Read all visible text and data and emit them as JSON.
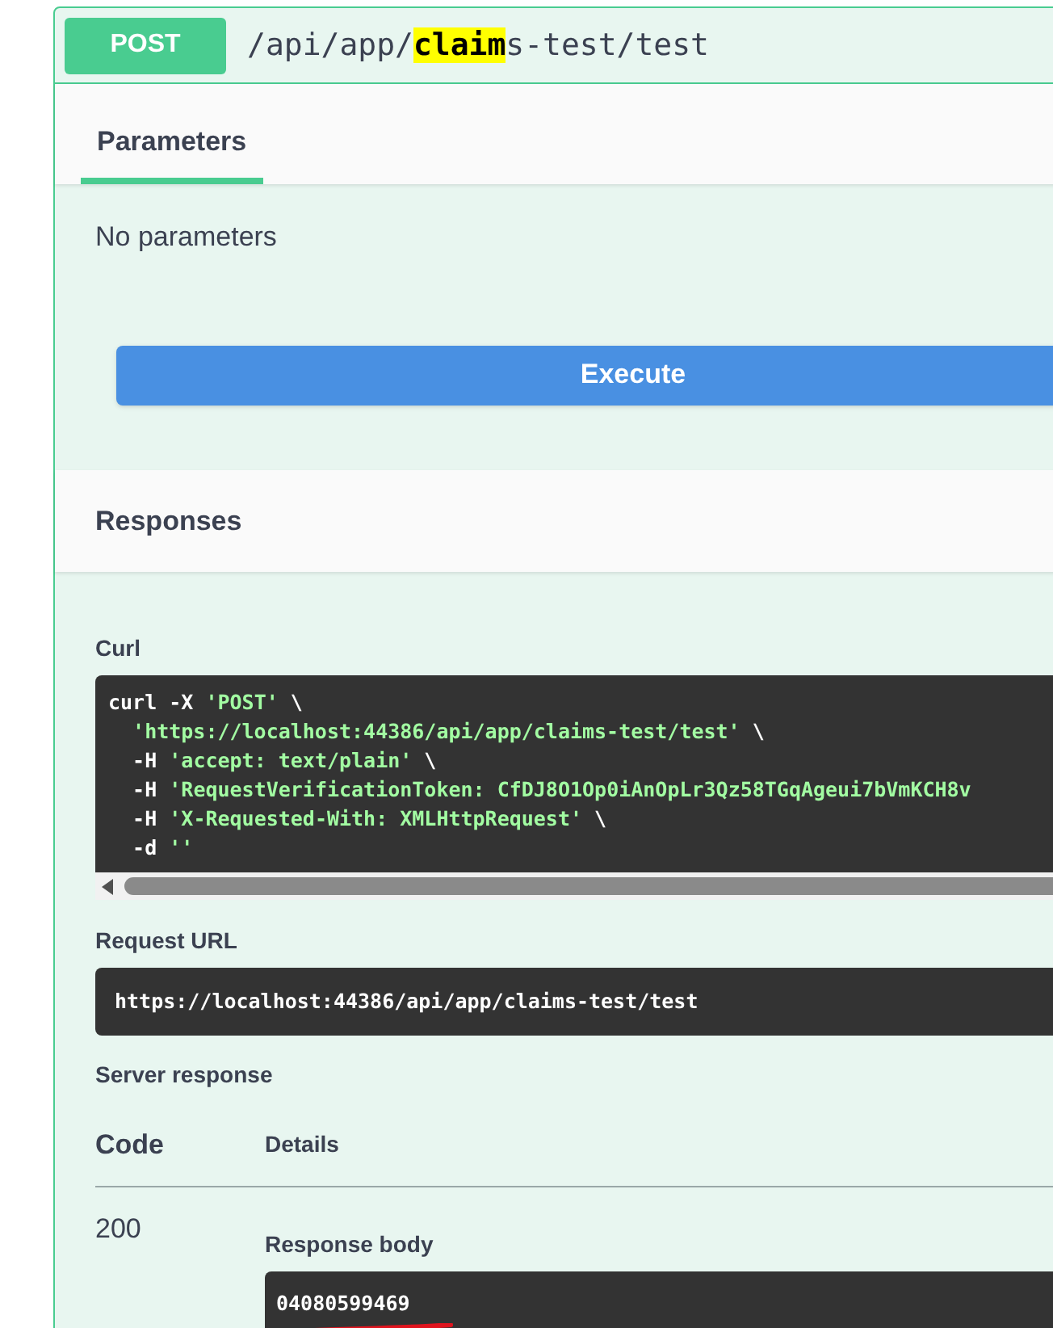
{
  "operation": {
    "method": "POST",
    "path": [
      {
        "text": "/api/app/",
        "highlighted": false
      },
      {
        "text": "claim",
        "highlighted": true
      },
      {
        "text": "s-test/test",
        "highlighted": false
      }
    ]
  },
  "parameters": {
    "tab": {
      "label": "Parameters",
      "selected": true
    },
    "message": "No parameters",
    "execute_button": "Execute"
  },
  "responses": {
    "title": "Responses",
    "curl": {
      "label": "Curl",
      "lines": [
        [
          {
            "kind": "plain",
            "text": "curl -X "
          },
          {
            "kind": "string",
            "text": "'POST'"
          },
          {
            "kind": "plain",
            "text": " \\"
          }
        ],
        [
          {
            "kind": "string",
            "text": "  'https://localhost:44386/api/app/claims-test/test'"
          },
          {
            "kind": "plain",
            "text": " \\"
          }
        ],
        [
          {
            "kind": "plain",
            "text": "  -H "
          },
          {
            "kind": "string",
            "text": "'accept: text/plain'"
          },
          {
            "kind": "plain",
            "text": " \\"
          }
        ],
        [
          {
            "kind": "plain",
            "text": "  -H "
          },
          {
            "kind": "string",
            "text": "'RequestVerificationToken: CfDJ8O1Op0iAnOpLr3Qz58TGqAgeui7bVmKCH8v"
          }
        ],
        [
          {
            "kind": "plain",
            "text": "  -H "
          },
          {
            "kind": "string",
            "text": "'X-Requested-With: XMLHttpRequest'"
          },
          {
            "kind": "plain",
            "text": " \\"
          }
        ],
        [
          {
            "kind": "plain",
            "text": "  -d "
          },
          {
            "kind": "string",
            "text": "''"
          }
        ]
      ]
    },
    "request_url": {
      "label": "Request URL",
      "value": "https://localhost:44386/api/app/claims-test/test"
    },
    "server_response": {
      "label": "Server response",
      "columns": [
        "Code",
        "Details"
      ],
      "rows": [
        {
          "code": "200",
          "body_label": "Response body",
          "body": "04080599469"
        }
      ]
    }
  }
}
